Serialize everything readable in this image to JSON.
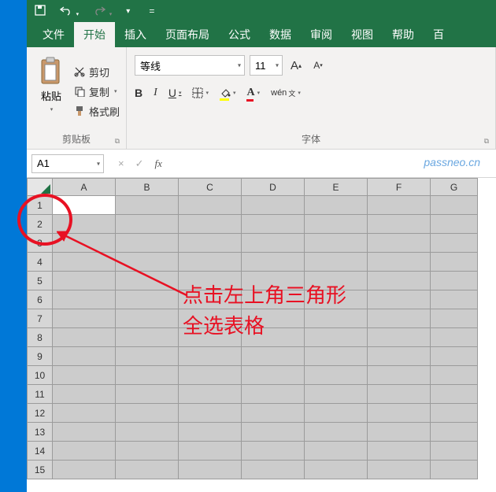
{
  "qat": {
    "save": "save-icon",
    "undo": "undo-icon",
    "redo": "redo-icon"
  },
  "tabs": {
    "file": "文件",
    "home": "开始",
    "insert": "插入",
    "layout": "页面布局",
    "formula": "公式",
    "data": "数据",
    "review": "审阅",
    "view": "视图",
    "help": "帮助",
    "baidu": "百"
  },
  "ribbon": {
    "clipboard": {
      "paste": "粘贴",
      "cut": "剪切",
      "copy": "复制",
      "format_painter": "格式刷",
      "group_label": "剪贴板"
    },
    "font": {
      "name": "等线",
      "size": "11",
      "group_label": "字体",
      "increase_hint": "A",
      "decrease_hint": "A",
      "bold": "B",
      "italic": "I",
      "underline": "U",
      "wen": "wén"
    }
  },
  "namebox": {
    "value": "A1"
  },
  "formula_bar": {
    "cancel": "×",
    "confirm": "✓",
    "fx": "fx"
  },
  "watermark": "passneo.cn",
  "grid": {
    "cols": [
      "A",
      "B",
      "C",
      "D",
      "E",
      "F",
      "G"
    ],
    "rows": [
      "1",
      "2",
      "3",
      "4",
      "5",
      "6",
      "7",
      "8",
      "9",
      "10",
      "11",
      "12",
      "13",
      "14",
      "15"
    ]
  },
  "annotation": {
    "line1": "点击左上角三角形",
    "line2": "全选表格"
  }
}
